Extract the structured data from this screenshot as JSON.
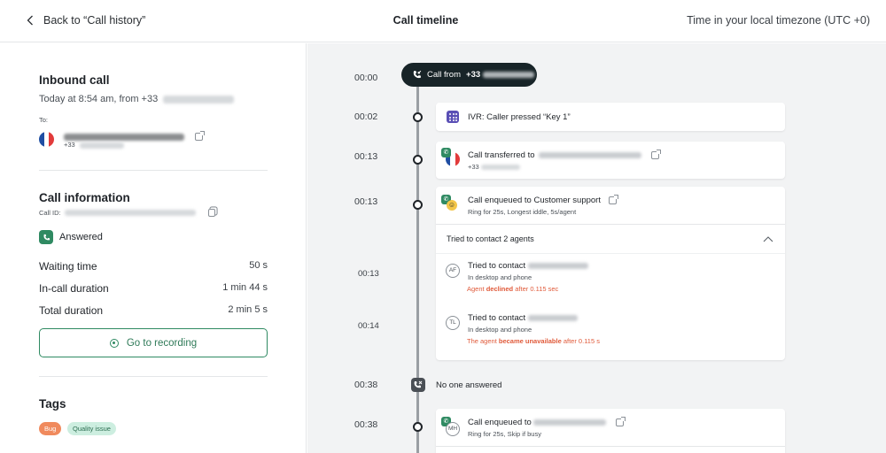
{
  "header": {
    "back_label": "Back to “Call history”",
    "title": "Call timeline",
    "timezone": "Time in your local timezone (UTC +0)"
  },
  "summary": {
    "heading": "Inbound call",
    "when": "Today at 8:54 am, from +33",
    "to_label": "To:",
    "to_number_prefix": "+33"
  },
  "call_info": {
    "heading": "Call information",
    "call_id_label": "Call ID:",
    "status": "Answered",
    "metrics": [
      {
        "label": "Waiting time",
        "value": "50 s"
      },
      {
        "label": "In-call duration",
        "value": "1 min 44 s"
      },
      {
        "label": "Total duration",
        "value": "2 min 5 s"
      }
    ],
    "recording_button": "Go to recording"
  },
  "tags": {
    "heading": "Tags",
    "items": [
      {
        "label": "Bug",
        "color": "#f08a5d",
        "text_color": "#ffffff"
      },
      {
        "label": "Quality issue",
        "color": "#cdeee0",
        "text_color": "#2b6d50"
      }
    ]
  },
  "timeline": {
    "times": {
      "t0": "00:00",
      "t1": "00:02",
      "t2": "00:13",
      "t3": "00:13",
      "t4": "00:13",
      "t5": "00:14",
      "t6": "00:38",
      "t7": "00:38"
    },
    "call_from_prefix": "Call from",
    "call_from_number": "+33",
    "ivr_text": "IVR: Caller pressed “Key 1”",
    "transfer_text": "Call transferred to",
    "transfer_number_prefix": "+33",
    "enqueued_title": "Call enqueued to Customer support",
    "enqueued_sub": "Ring for 25s, Longest iddle, 5s/agent",
    "tried_header": "Tried to contact 2 agents",
    "agents": [
      {
        "initials": "AF",
        "title_prefix": "Tried to contact",
        "device": "In desktop and phone",
        "outcome_prefix": "Agent",
        "outcome_bold": "declined",
        "outcome_suffix": "after 0.115 sec"
      },
      {
        "initials": "TL",
        "title_prefix": "Tried to contact",
        "device": "In desktop and phone",
        "outcome_prefix": "The agent",
        "outcome_bold": "became unavailable",
        "outcome_suffix": "after 0.115 s"
      }
    ],
    "no_answer": "No one answered",
    "enqueued2_prefix": "Call enqueued to",
    "enqueued2_sub": "Ring for 25s, Skip if busy",
    "enqueued2_initials": "MH"
  },
  "colors": {
    "accent_green": "#2f8a62",
    "pill_dark": "#182428",
    "warning_red": "#e05a3a",
    "ivr_purple": "#5a4fb5"
  }
}
